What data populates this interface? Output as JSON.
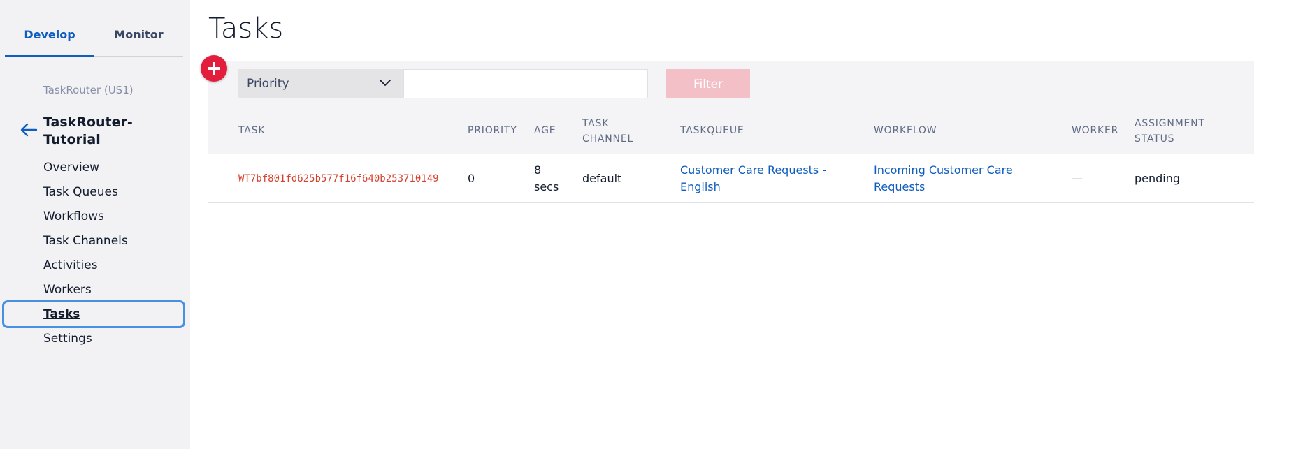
{
  "sidebar": {
    "tabs": [
      {
        "label": "Develop",
        "active": true
      },
      {
        "label": "Monitor",
        "active": false
      }
    ],
    "breadcrumb": "TaskRouter (US1)",
    "project_title": "TaskRouter-Tutorial",
    "items": [
      {
        "label": "Overview"
      },
      {
        "label": "Task Queues"
      },
      {
        "label": "Workflows"
      },
      {
        "label": "Task Channels"
      },
      {
        "label": "Activities"
      },
      {
        "label": "Workers"
      },
      {
        "label": "Tasks",
        "active": true
      },
      {
        "label": "Settings"
      }
    ]
  },
  "main": {
    "title": "Tasks",
    "filter": {
      "add_icon": "plus-circle-icon",
      "select_value": "Priority",
      "input_value": "",
      "button_label": "Filter"
    },
    "table": {
      "headers": {
        "task": "TASK",
        "priority": "PRIORITY",
        "age": "AGE",
        "task_channel": [
          "TASK",
          "CHANNEL"
        ],
        "taskqueue": "TASKQUEUE",
        "workflow": "WORKFLOW",
        "worker": "WORKER",
        "assignment_status": [
          "ASSIGNMENT",
          "STATUS"
        ]
      },
      "rows": [
        {
          "task": "WT7bf801fd625b577f16f640b253710149",
          "priority": "0",
          "age": [
            "8",
            "secs"
          ],
          "task_channel": "default",
          "taskqueue": [
            "Customer Care Requests -",
            "English"
          ],
          "workflow": [
            "Incoming Customer Care",
            "Requests"
          ],
          "worker": "—",
          "assignment_status": "pending"
        }
      ]
    }
  },
  "colors": {
    "accent": "#0f5dbf",
    "add_button": "#e31e3c",
    "task_sid": "#d6412f",
    "filter_button_disabled": "#f4c0c7",
    "active_nav_outline": "#4a90e2"
  }
}
